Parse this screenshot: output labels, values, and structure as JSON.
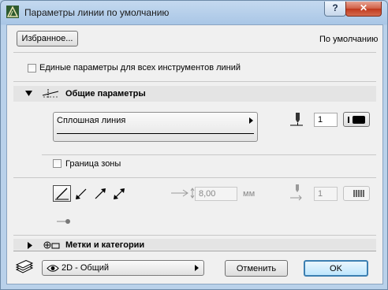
{
  "window": {
    "title": "Параметры линии по умолчанию",
    "help_label": "?",
    "close_label": "✕"
  },
  "top": {
    "favorites_label": "Избранное...",
    "default_label": "По умолчанию"
  },
  "uniform_params": {
    "label": "Единые параметры для всех инструментов линий",
    "checked": false
  },
  "general_panel": {
    "title": "Общие параметры",
    "line_type": "Сплошная линия",
    "pen_number": "1",
    "zone_border_label": "Граница зоны",
    "offset_value": "8,00",
    "offset_unit": "мм",
    "pen_number_disabled": "1"
  },
  "tags_panel": {
    "title": "Метки и категории"
  },
  "footer": {
    "layer_value": "2D - Общий",
    "cancel_label": "Отменить",
    "ok_label": "OK"
  },
  "colors": {
    "titlebar": "#b9d1ea",
    "client": "#f0f0f0",
    "close": "#c0391d"
  }
}
